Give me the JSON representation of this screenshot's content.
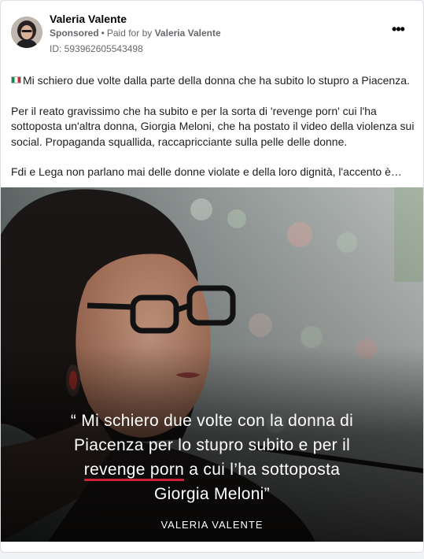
{
  "post": {
    "author": "Valeria Valente",
    "sponsored_label": "Sponsored",
    "separator": "•",
    "paid_for_by_label": "Paid for by",
    "paid_for_by": "Valeria Valente",
    "id_label": "ID: 593962605543498",
    "more_icon": "more-horizontal-icon",
    "paragraphs": [
      "Mi schiero due volte dalla parte della donna che ha subito lo stupro a Piacenza.",
      "Per il reato gravissimo che ha subito e per la sorta di 'revenge porn' cui l'ha sottoposta un'altra donna, Giorgia Meloni, che ha postato il video della violenza sui social. Propaganda squallida, raccapricciante sulla pelle delle donne.",
      "Fdi e Lega non parlano mai delle donne violate e della loro dignità, l'accento è…"
    ]
  },
  "media": {
    "quote_line1": "“ Mi schiero due volte con la donna di",
    "quote_line2": "Piacenza per lo stupro subito e per il",
    "quote_line3_highlight": "revenge porn",
    "quote_line3_rest": " a cui l’ha sottoposta",
    "quote_line4": "Giorgia Meloni”",
    "signature": "VALERIA VALENTE",
    "highlight_color": "#d0213b"
  }
}
